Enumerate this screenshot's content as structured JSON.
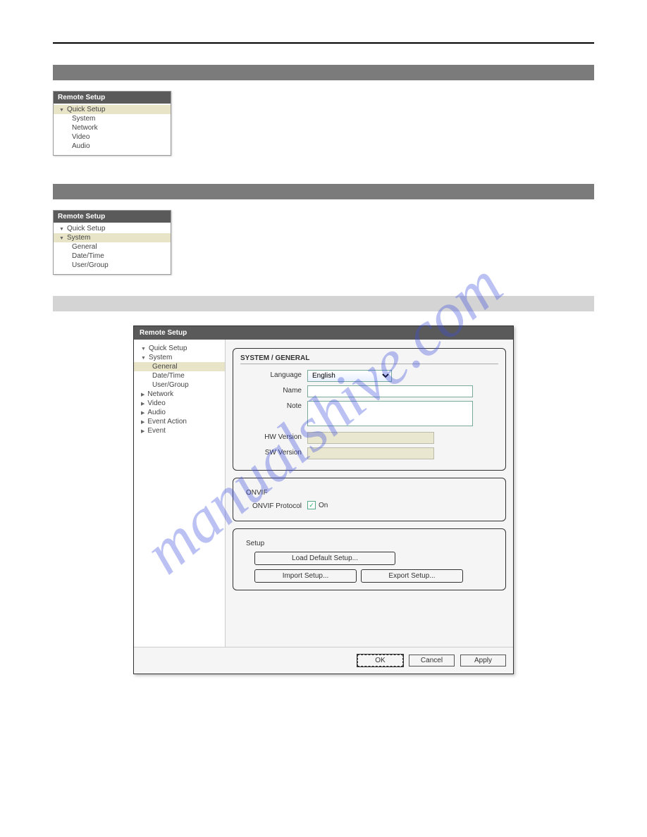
{
  "watermark": "manualshive.com",
  "panels": {
    "header": "Remote Setup",
    "quick": {
      "root": "Quick Setup",
      "items": [
        "System",
        "Network",
        "Video",
        "Audio"
      ]
    },
    "system_small": {
      "root": "Quick Setup",
      "sys": "System",
      "items": [
        "General",
        "Date/Time",
        "User/Group"
      ]
    }
  },
  "large": {
    "header": "Remote Setup",
    "sidebar": {
      "quick": "Quick Setup",
      "system": "System",
      "system_items": [
        "General",
        "Date/Time",
        "User/Group"
      ],
      "others": [
        "Network",
        "Video",
        "Audio",
        "Event Action",
        "Event"
      ]
    },
    "main": {
      "title": "SYSTEM / GENERAL",
      "labels": {
        "language": "Language",
        "name": "Name",
        "note": "Note",
        "hw": "HW Version",
        "sw": "SW Version"
      },
      "values": {
        "language": "English",
        "name": "",
        "note": "",
        "hw": "",
        "sw": ""
      },
      "onvif": {
        "legend": "ONVIF",
        "label": "ONVIF Protocol",
        "checked": true,
        "checktext": "On"
      },
      "setup": {
        "legend": "Setup",
        "load": "Load Default Setup...",
        "import": "Import Setup...",
        "export": "Export Setup..."
      },
      "footer": {
        "ok": "OK",
        "cancel": "Cancel",
        "apply": "Apply"
      }
    }
  }
}
